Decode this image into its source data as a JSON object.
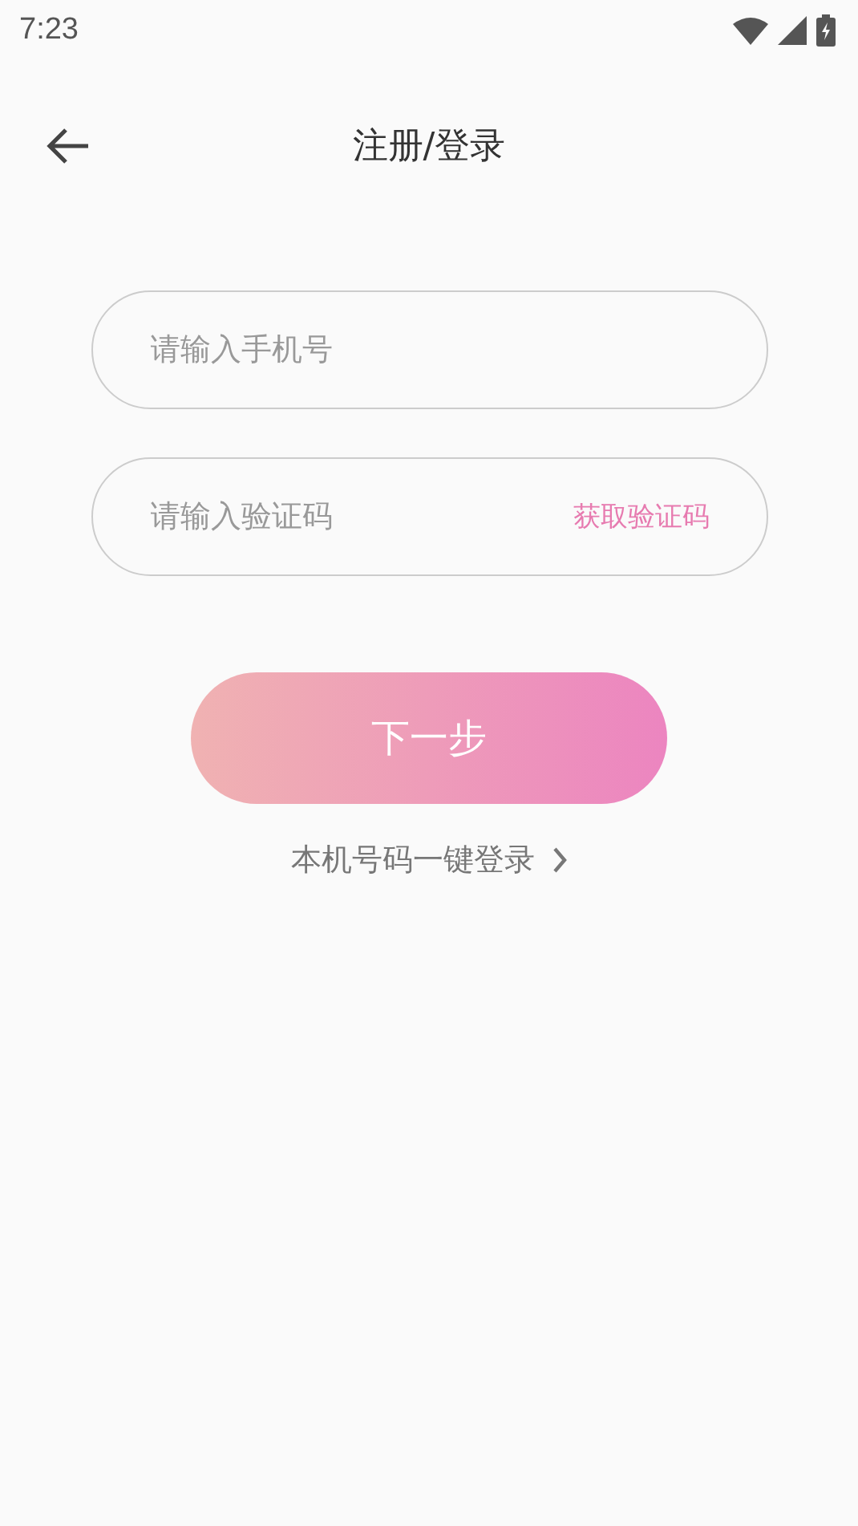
{
  "status_bar": {
    "time": "7:23"
  },
  "header": {
    "title": "注册/登录"
  },
  "phone_field": {
    "placeholder": "请输入手机号"
  },
  "code_field": {
    "placeholder": "请输入验证码",
    "action": "获取验证码"
  },
  "next_button": {
    "label": "下一步"
  },
  "one_tap_login": {
    "label": "本机号码一键登录"
  }
}
